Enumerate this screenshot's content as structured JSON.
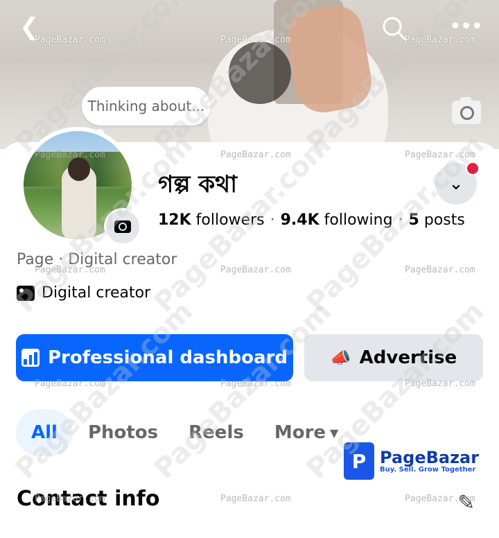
{
  "header": {
    "back_icon": "chevron-left-icon",
    "search_icon": "search-icon",
    "more_icon": "more-horizontal-icon"
  },
  "cover": {
    "camera_icon": "camera-icon"
  },
  "note": {
    "text": "Thinking about..."
  },
  "profile": {
    "name": "গল্প কথা",
    "followers": "12K",
    "followers_label": "followers",
    "following": "9.4K",
    "following_label": "following",
    "posts": "5",
    "posts_label": "posts",
    "category": "Page · Digital creator",
    "creator_label": "Digital creator"
  },
  "actions": {
    "primary_label": "Professional dashboard",
    "secondary_label": "Advertise"
  },
  "tabs": [
    {
      "label": "All",
      "active": true
    },
    {
      "label": "Photos",
      "active": false
    },
    {
      "label": "Reels",
      "active": false
    },
    {
      "label": "More",
      "active": false
    }
  ],
  "section": {
    "title": "Contact info"
  },
  "watermark": {
    "text": "PageBazar.com",
    "brand_name": "PageBazar",
    "brand_tagline": "Buy. Sell. Grow Together",
    "brand_letter": "P"
  },
  "colors": {
    "accent": "#0866ff",
    "notification": "#e41e3f",
    "secondary_button": "#e4e6eb"
  }
}
